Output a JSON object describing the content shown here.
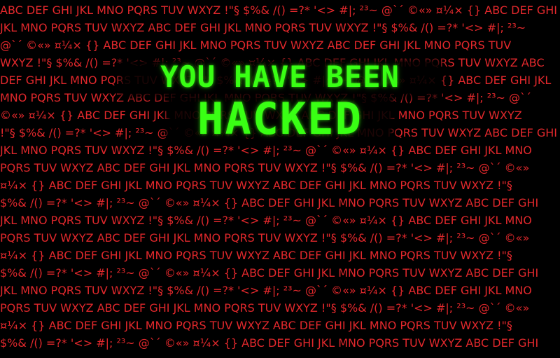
{
  "headline": {
    "line_1": "YOU HAVE BEEN",
    "line_2": "HACKED"
  },
  "background_text": {
    "line_01": "ABC DEF GHI JKL MNO PQRS TUV WXYZ !\"§ $%& /() =?* '<> #|; ²³~ @`´ ©«» ¤¼× {} ABC DEF GHI",
    "line_02": "JKL MNO PQRS TUV WXYZ ABC DEF GHI JKL MNO PQRS TUV WXYZ !\"§ $%& /() =?* '<> #|; ²³~",
    "line_03": "@`´ ©«» ¤¼× {} ABC DEF GHI JKL MNO PQRS TUV WXYZ ABC DEF GHI JKL MNO PQRS TUV",
    "line_04": "WXYZ !\"§ $%& /() =?* '<> #|; ²³~ @`´ ©«» ¤¼× {} ABC DEF GHI JKL MNO PQRS TUV WXYZ ABC",
    "line_05": "DEF GHI JKL MNO PQRS TUV WXYZ !\"§ $%& /() =?* '<> #|; ²³~ @`´ ©«» ¤¼× {} ABC DEF GHI JKL",
    "line_06": "MNO PQRS TUV WXYZ ABC DEF GHI JKL MNO PQRS TUV WXYZ !\"§ $%& /() =?* '<> #|; ²³~ @`´",
    "line_07": "©«» ¤¼× {} ABC DEF GHI JKL MNO PQRS TUV WXYZ ABC DEF GHI JKL MNO PQRS TUV WXYZ",
    "line_08": "!\"§ $%& /() =?* '<> #|; ²³~ @`´ ©«» ¤¼× {} ABC DEF GHI JKL MNO PQRS TUV WXYZ ABC DEF GHI",
    "line_09": "JKL MNO PQRS TUV WXYZ !\"§ $%& /() =?* '<> #|; ²³~ @`´ ©«» ¤¼× {} ABC DEF GHI JKL MNO",
    "line_10": "PQRS TUV WXYZ ABC DEF GHI JKL MNO PQRS TUV WXYZ !\"§ $%& /() =?* '<> #|; ²³~ @`´ ©«»",
    "line_11": "¤¼× {} ABC DEF GHI JKL MNO PQRS TUV WXYZ ABC DEF GHI JKL MNO PQRS TUV WXYZ !\"§",
    "line_12": "$%& /() =?* '<> #|; ²³~ @`´ ©«» ¤¼× {} ABC DEF GHI JKL MNO PQRS TUV WXYZ ABC DEF GHI",
    "line_13": "JKL MNO PQRS TUV WXYZ !\"§ $%& /() =?* '<> #|; ²³~ @`´ ©«» ¤¼× {} ABC DEF GHI JKL MNO",
    "line_14": "PQRS TUV WXYZ ABC DEF GHI JKL MNO PQRS TUV WXYZ !\"§ $%& /() =?* '<> #|; ²³~ @`´ ©«»",
    "line_15": "¤¼× {} ABC DEF GHI JKL MNO PQRS TUV WXYZ ABC DEF GHI JKL MNO PQRS TUV WXYZ !\"§",
    "line_16": "$%& /() =?* '<> #|; ²³~ @`´ ©«» ¤¼× {} ABC DEF GHI JKL MNO PQRS TUV WXYZ ABC DEF GHI",
    "line_17": "JKL MNO PQRS TUV WXYZ !\"§ $%& /() =?* '<> #|; ²³~ @`´ ©«» ¤¼× {} ABC DEF GHI JKL MNO",
    "line_18": "PQRS TUV WXYZ ABC DEF GHI JKL MNO PQRS TUV WXYZ !\"§ $%& /() =?* '<> #|; ²³~ @`´ ©«»",
    "line_19": "¤¼× {} ABC DEF GHI JKL MNO PQRS TUV WXYZ ABC DEF GHI JKL MNO PQRS TUV WXYZ !\"§",
    "line_20": "$%& /() =?* '<> #|; ²³~ @`´ ©«» ¤¼× {} ABC DEF GHI JKL MNO PQRS TUV WXYZ ABC DEF GHI"
  },
  "colors": {
    "background": "#000000",
    "background_text": "#e2282c",
    "headline": "#39ff14"
  }
}
